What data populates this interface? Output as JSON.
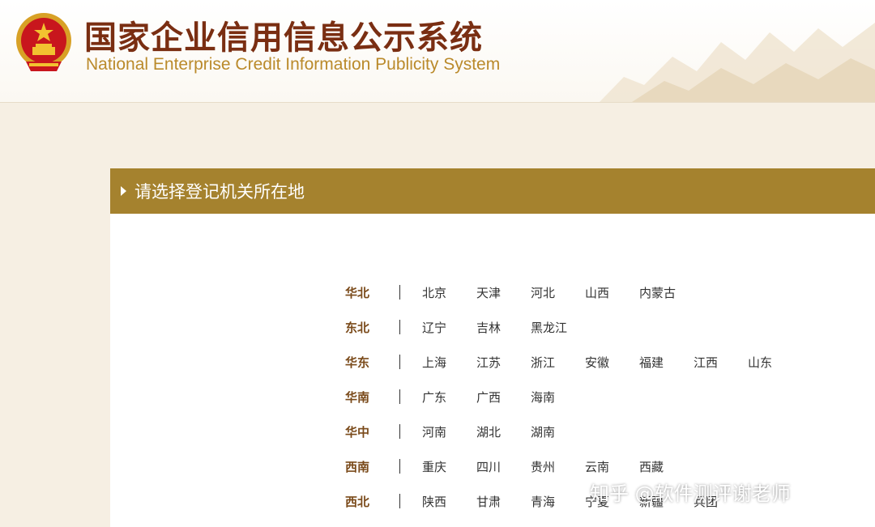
{
  "header": {
    "title_cn": "国家企业信用信息公示系统",
    "title_en": "National Enterprise Credit Information Publicity System"
  },
  "panel": {
    "title": "请选择登记机关所在地"
  },
  "regions": [
    {
      "name": "华北",
      "cities": [
        "北京",
        "天津",
        "河北",
        "山西",
        "内蒙古"
      ]
    },
    {
      "name": "东北",
      "cities": [
        "辽宁",
        "吉林",
        "黑龙江"
      ]
    },
    {
      "name": "华东",
      "cities": [
        "上海",
        "江苏",
        "浙江",
        "安徽",
        "福建",
        "江西",
        "山东"
      ]
    },
    {
      "name": "华南",
      "cities": [
        "广东",
        "广西",
        "海南"
      ]
    },
    {
      "name": "华中",
      "cities": [
        "河南",
        "湖北",
        "湖南"
      ]
    },
    {
      "name": "西南",
      "cities": [
        "重庆",
        "四川",
        "贵州",
        "云南",
        "西藏"
      ]
    },
    {
      "name": "西北",
      "cities": [
        "陕西",
        "甘肃",
        "青海",
        "宁夏",
        "新疆",
        "兵团"
      ]
    }
  ],
  "watermark": "知乎 @软件测评谢老师",
  "colors": {
    "panel_header": "#a5822e",
    "title_cn": "#7a2e12",
    "title_en": "#ba8a2b",
    "region_label": "#7a4a1a",
    "background": "#f6efe3"
  },
  "icons": {
    "emblem": "national-emblem-icon",
    "panel_arrow": "triangle-right-icon"
  }
}
